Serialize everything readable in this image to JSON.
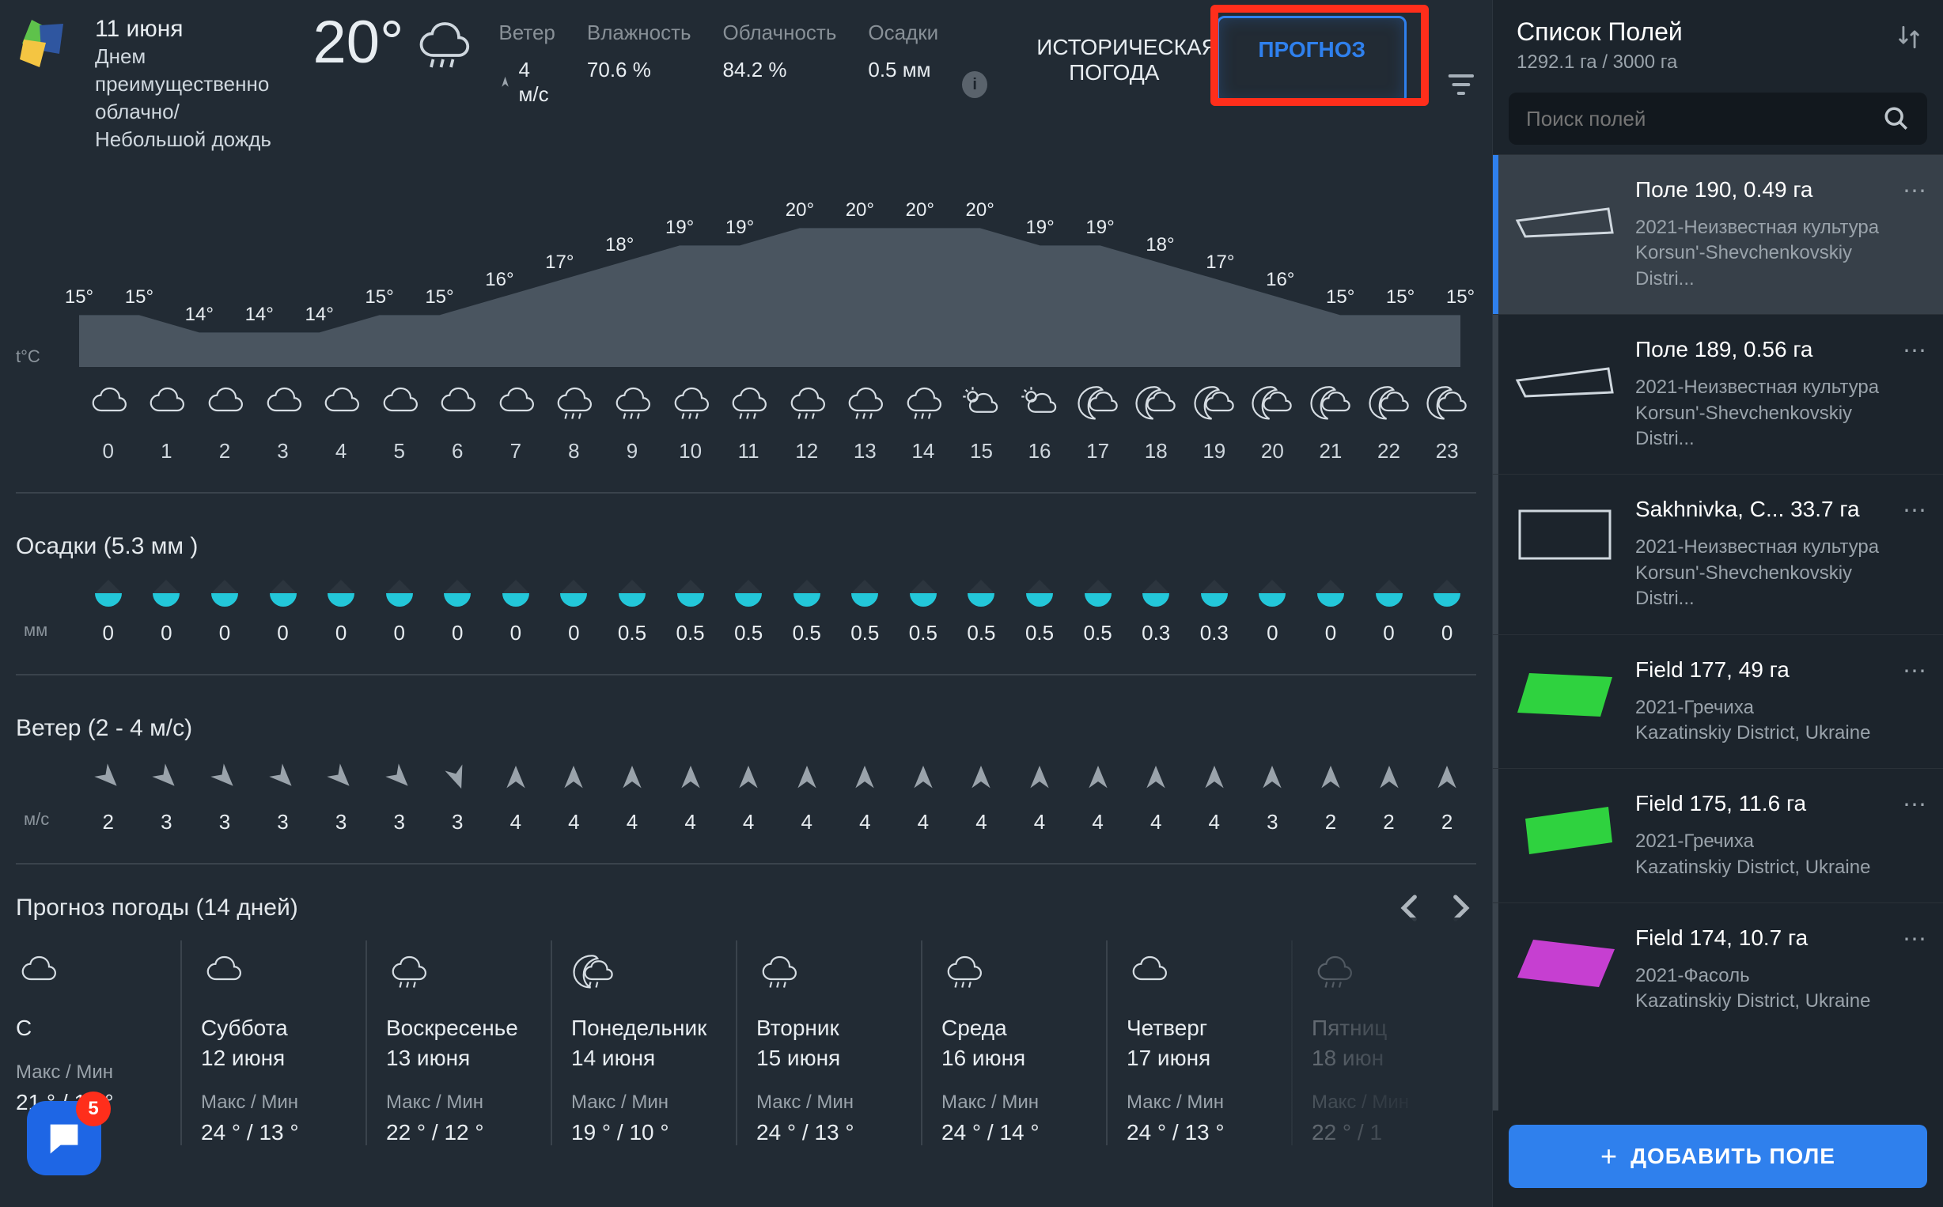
{
  "header": {
    "date": "11 июня",
    "description": "Днем преимущественно облачно/ Небольшой дождь",
    "temp": "20°",
    "stats": {
      "wind_label": "Ветер",
      "wind_val": "4 м/с",
      "humidity_label": "Влажность",
      "humidity_val": "70.6 %",
      "clouds_label": "Облачность",
      "clouds_val": "84.2 %",
      "precip_label": "Осадки",
      "precip_val": "0.5 мм"
    },
    "tabs": {
      "historical": "ИСТОРИЧЕСКАЯ ПОГОДА",
      "forecast": "ПРОГНОЗ"
    }
  },
  "chart_data": {
    "type": "area",
    "title": "",
    "xlabel": "",
    "ylabel": "t°C",
    "x": [
      0,
      1,
      2,
      3,
      4,
      5,
      6,
      7,
      8,
      9,
      10,
      11,
      12,
      13,
      14,
      15,
      16,
      17,
      18,
      19,
      20,
      21,
      22,
      23
    ],
    "values": [
      15,
      15,
      14,
      14,
      14,
      15,
      15,
      16,
      17,
      18,
      19,
      19,
      20,
      20,
      20,
      20,
      19,
      19,
      18,
      17,
      16,
      15,
      15,
      15
    ],
    "ylim": [
      12,
      22
    ]
  },
  "hourly": {
    "axis_label": "t°C",
    "hours": [
      "0",
      "1",
      "2",
      "3",
      "4",
      "5",
      "6",
      "7",
      "8",
      "9",
      "10",
      "11",
      "12",
      "13",
      "14",
      "15",
      "16",
      "17",
      "18",
      "19",
      "20",
      "21",
      "22",
      "23"
    ],
    "icons": [
      "cloud",
      "cloud",
      "cloud",
      "cloud",
      "cloud",
      "cloud",
      "cloud",
      "cloud",
      "rain",
      "rain",
      "rain",
      "rain",
      "rain",
      "rain",
      "rain",
      "suncloud",
      "suncloud",
      "moon",
      "moon",
      "moon",
      "moon",
      "moon",
      "moon",
      "moon"
    ]
  },
  "precip": {
    "title": "Осадки (5.3 мм )",
    "unit": "мм",
    "values": [
      "0",
      "0",
      "0",
      "0",
      "0",
      "0",
      "0",
      "0",
      "0",
      "0.5",
      "0.5",
      "0.5",
      "0.5",
      "0.5",
      "0.5",
      "0.5",
      "0.5",
      "0.5",
      "0.3",
      "0.3",
      "0",
      "0",
      "0",
      "0"
    ]
  },
  "wind": {
    "title": "Ветер (2 - 4 м/с)",
    "unit": "м/с",
    "values": [
      "2",
      "3",
      "3",
      "3",
      "3",
      "3",
      "3",
      "4",
      "4",
      "4",
      "4",
      "4",
      "4",
      "4",
      "4",
      "4",
      "4",
      "4",
      "4",
      "4",
      "3",
      "2",
      "2",
      "2"
    ],
    "dirs": [
      135,
      135,
      135,
      135,
      135,
      135,
      160,
      0,
      0,
      0,
      0,
      0,
      0,
      0,
      0,
      0,
      0,
      0,
      0,
      0,
      0,
      0,
      0,
      0
    ]
  },
  "forecast14": {
    "title": "Прогноз погоды (14 дней)",
    "mm_label": "Макс / Мин",
    "days": [
      {
        "icon": "cloud",
        "name": "С",
        "date": "",
        "mm": "21 ° / 13 °",
        "cut": true
      },
      {
        "icon": "cloud",
        "name": "Суббота",
        "date": "12 июня",
        "mm": "24 ° / 13 °"
      },
      {
        "icon": "rain",
        "name": "Воскресенье",
        "date": "13 июня",
        "mm": "22 ° / 12 °"
      },
      {
        "icon": "moonrain",
        "name": "Понедельник",
        "date": "14 июня",
        "mm": "19 ° / 10 °"
      },
      {
        "icon": "rain",
        "name": "Вторник",
        "date": "15 июня",
        "mm": "24 ° / 13 °"
      },
      {
        "icon": "rain",
        "name": "Среда",
        "date": "16 июня",
        "mm": "24 ° / 14 °"
      },
      {
        "icon": "cloud",
        "name": "Четверг",
        "date": "17 июня",
        "mm": "24 ° / 13 °"
      },
      {
        "icon": "rain",
        "name": "Пятниц",
        "date": "18 июн",
        "mm": "22 ° / 1",
        "faded": true
      }
    ]
  },
  "sidebar": {
    "title": "Список Полей",
    "sub": "1292.1 га / 3000 га",
    "search_ph": "Поиск полей",
    "add_btn": "ДОБАВИТЬ ПОЛЕ",
    "fields": [
      {
        "name": "Поле 190, 0.49 га",
        "meta1": "2021-Неизвестная культура",
        "meta2": "Korsun'-Shevchenkovskiy Distri...",
        "shape": "outline-trap",
        "selected": true
      },
      {
        "name": "Поле 189, 0.56 га",
        "meta1": "2021-Неизвестная культура",
        "meta2": "Korsun'-Shevchenkovskiy Distri...",
        "shape": "outline-trap"
      },
      {
        "name": "Sakhnivka, С...  33.7 га",
        "meta1": "2021-Неизвестная культура",
        "meta2": "Korsun'-Shevchenkovskiy Distri...",
        "shape": "outline-rect"
      },
      {
        "name": "Field 177, 49 га",
        "meta1": "2021-Гречиха",
        "meta2": "Kazatinskiy District, Ukraine",
        "shape": "green-para"
      },
      {
        "name": "Field 175, 11.6 га",
        "meta1": "2021-Гречиха",
        "meta2": "Kazatinskiy District, Ukraine",
        "shape": "green-para2"
      },
      {
        "name": "Field 174, 10.7 га",
        "meta1": "2021-Фасоль",
        "meta2": "Kazatinskiy District, Ukraine",
        "shape": "magenta-para"
      }
    ]
  },
  "chat": {
    "count": "5"
  }
}
